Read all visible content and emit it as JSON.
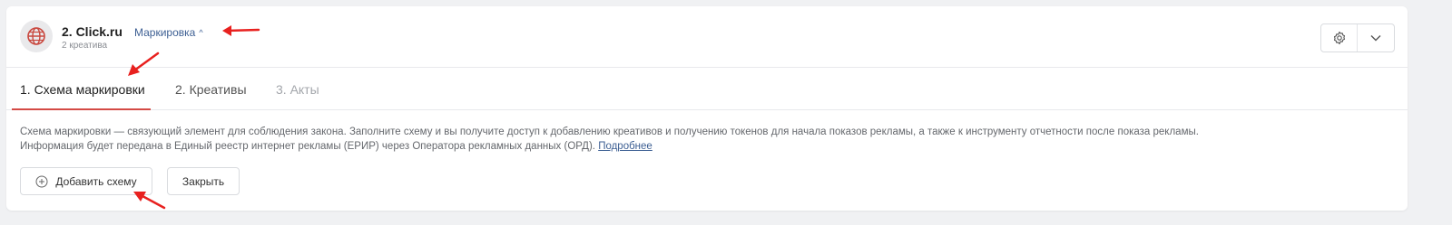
{
  "header": {
    "title": "2. Click.ru",
    "subtitle": "2 креатива",
    "marking_link": "Маркировка",
    "marking_chevron": "^"
  },
  "tabs": [
    {
      "label": "1. Схема маркировки",
      "state": "active"
    },
    {
      "label": "2. Креативы",
      "state": "normal"
    },
    {
      "label": "3. Акты",
      "state": "disabled"
    }
  ],
  "description": {
    "line1": "Схема маркировки — связующий элемент для соблюдения закона. Заполните схему и вы получите доступ к добавлению креативов и получению токенов для начала показов рекламы, а также к инструменту отчетности после показа рекламы.",
    "line2": "Информация будет передана в Единый реестр интернет рекламы (ЕРИР) через Оператора рекламных данных (ОРД).",
    "link": "Подробнее"
  },
  "buttons": {
    "add_scheme": "Добавить схему",
    "close": "Закрыть"
  },
  "colors": {
    "accent_red": "#d44a45",
    "link_blue": "#3d5f93",
    "arrow_red": "#e8211f"
  },
  "icons": {
    "logo": "globe-icon",
    "settings": "gear-icon",
    "dropdown": "chevron-down-icon",
    "add": "plus-circle-icon"
  }
}
